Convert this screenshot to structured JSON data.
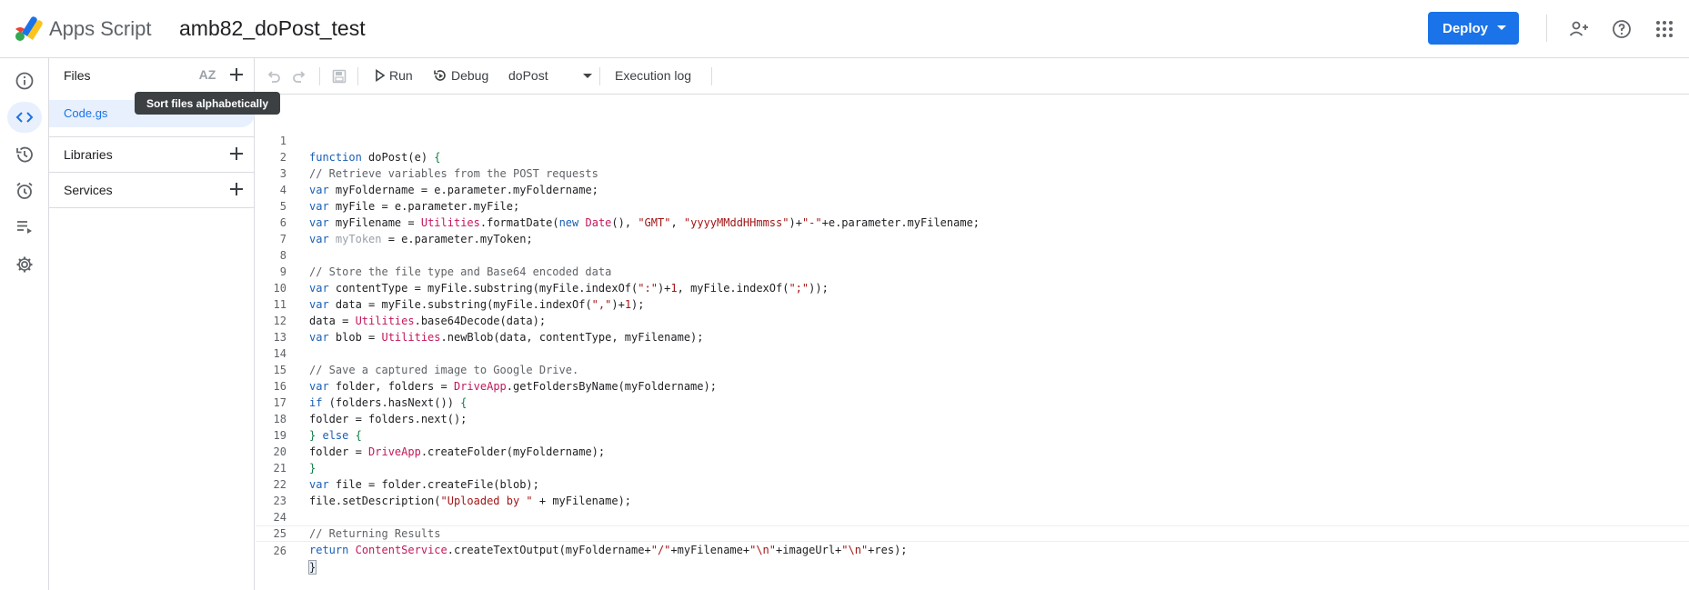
{
  "header": {
    "app_name": "Apps Script",
    "project_title": "amb82_doPost_test",
    "deploy_label": "Deploy"
  },
  "files_panel": {
    "files_label": "Files",
    "file_name": "Code.gs",
    "libraries_label": "Libraries",
    "services_label": "Services",
    "sort_tooltip": "Sort files alphabetically",
    "sort_glyph": "AZ"
  },
  "toolbar": {
    "run_label": "Run",
    "debug_label": "Debug",
    "function_name": "doPost",
    "execution_log_label": "Execution log"
  },
  "editor": {
    "line_numbers": [
      "1",
      "2",
      "3",
      "4",
      "5",
      "6",
      "7",
      "8",
      "9",
      "10",
      "11",
      "12",
      "13",
      "14",
      "15",
      "16",
      "17",
      "18",
      "19",
      "20",
      "21",
      "22",
      "23",
      "24",
      "25",
      "26"
    ]
  },
  "colors": {
    "accent": "#1a73e8",
    "keyword": "#1a5fb4",
    "comment": "#5f6368",
    "string": "#a31515",
    "builtin_class": "#c2185b"
  },
  "icons": {
    "rail": [
      "info-icon",
      "code-icon",
      "history-icon",
      "alarm-icon",
      "executions-icon",
      "settings-icon"
    ],
    "header": [
      "share-person-add-icon",
      "help-icon",
      "apps-grid-icon"
    ],
    "toolbar": [
      "undo-icon",
      "redo-icon",
      "save-icon",
      "play-icon",
      "debug-icon"
    ]
  }
}
